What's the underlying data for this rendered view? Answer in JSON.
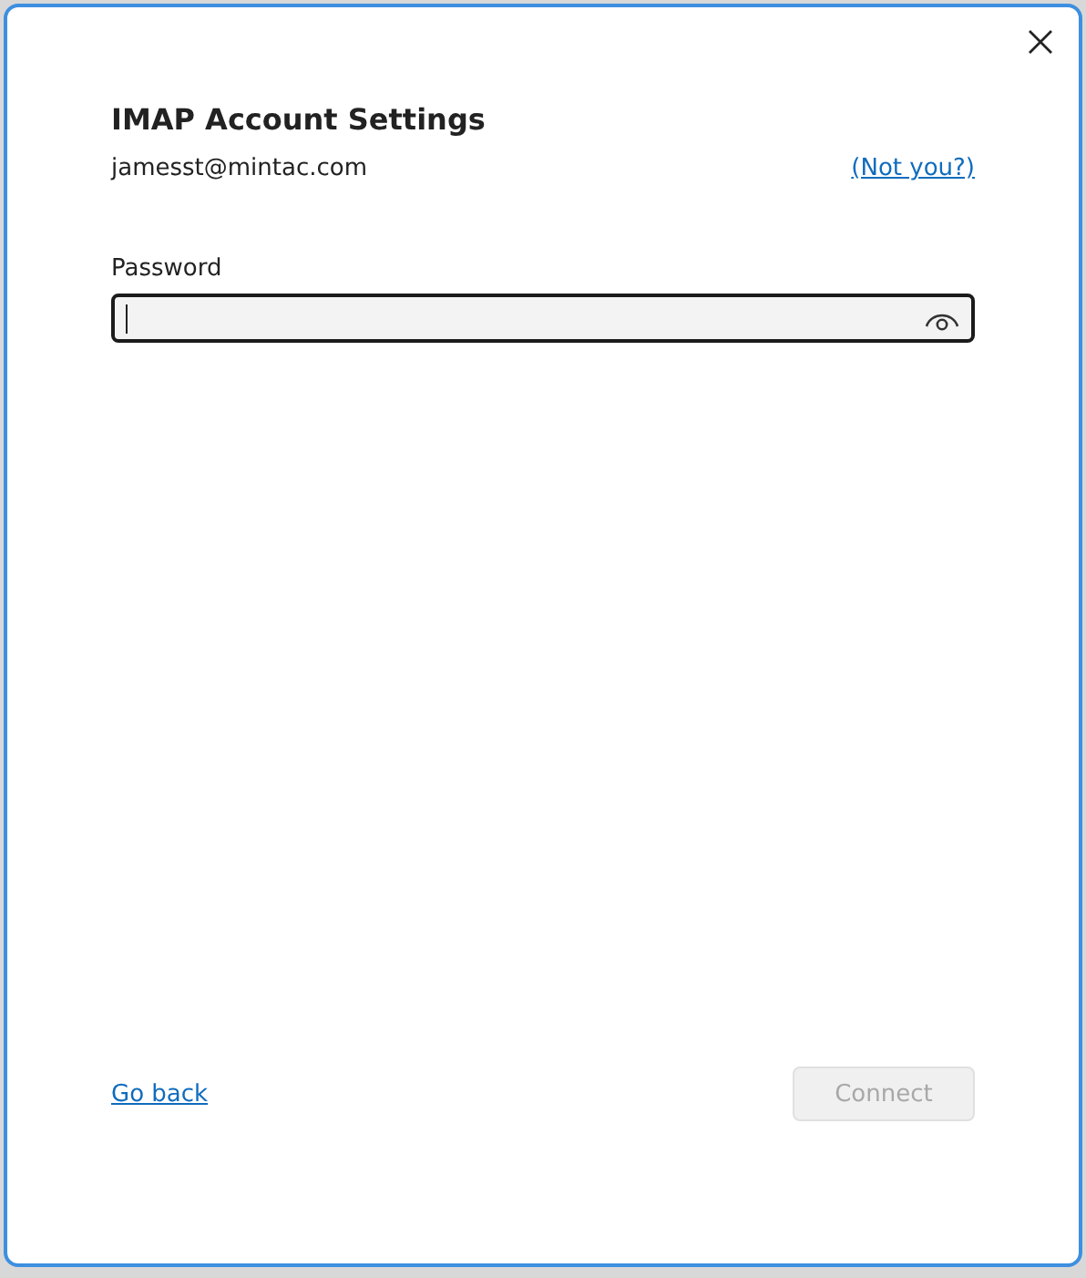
{
  "dialog": {
    "title": "IMAP Account Settings",
    "account": "jamesst@mintac.com",
    "switch_link": "(Not you?)",
    "password": {
      "label": "Password",
      "focused": true
    },
    "back_link": "Go back",
    "connect_button": {
      "label": "Connect",
      "disabled": true
    }
  }
}
